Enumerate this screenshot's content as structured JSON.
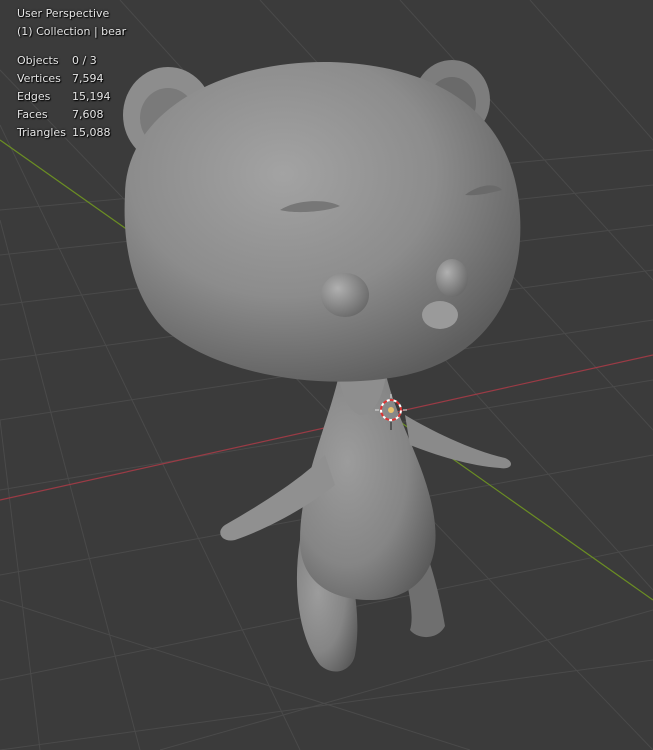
{
  "viewport": {
    "view_name": "User Perspective",
    "collection_line": "(1) Collection | bear",
    "stats": [
      {
        "label": "Objects",
        "value": "0 / 3"
      },
      {
        "label": "Vertices",
        "value": "7,594"
      },
      {
        "label": "Edges",
        "value": "15,194"
      },
      {
        "label": "Faces",
        "value": "7,608"
      },
      {
        "label": "Triangles",
        "value": "15,088"
      }
    ],
    "colors": {
      "background": "#3b3b3b",
      "grid": "#4a4a4a",
      "x_axis": "#9a3b45",
      "y_axis": "#6b8e23",
      "model": "#8a8a8a",
      "overlay_text": "#e6e6e6"
    },
    "icons": {
      "cursor": "3d-cursor-icon"
    }
  }
}
